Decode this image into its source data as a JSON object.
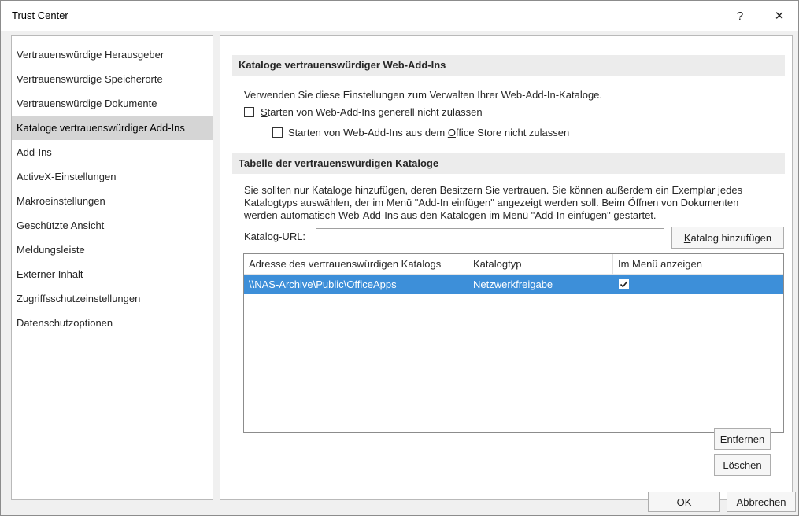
{
  "window": {
    "title": "Trust Center",
    "help_glyph": "?",
    "close_glyph": "✕"
  },
  "sidebar": {
    "items": [
      {
        "label": "Vertrauenswürdige Herausgeber",
        "selected": false
      },
      {
        "label": "Vertrauenswürdige Speicherorte",
        "selected": false
      },
      {
        "label": "Vertrauenswürdige Dokumente",
        "selected": false
      },
      {
        "label": "Kataloge vertrauenswürdiger Add-Ins",
        "selected": true
      },
      {
        "label": "Add-Ins",
        "selected": false
      },
      {
        "label": "ActiveX-Einstellungen",
        "selected": false
      },
      {
        "label": "Makroeinstellungen",
        "selected": false
      },
      {
        "label": "Geschützte Ansicht",
        "selected": false
      },
      {
        "label": "Meldungsleiste",
        "selected": false
      },
      {
        "label": "Externer Inhalt",
        "selected": false
      },
      {
        "label": "Zugriffsschutzeinstellungen",
        "selected": false
      },
      {
        "label": "Datenschutzoptionen",
        "selected": false
      }
    ]
  },
  "web_addins": {
    "header": "Kataloge vertrauenswürdiger Web-Add-Ins",
    "description": "Verwenden Sie diese Einstellungen zum Verwalten Ihrer Web-Add-In-Kataloge.",
    "checkbox1": {
      "pre": "",
      "u": "S",
      "post": "tarten von Web-Add-Ins generell nicht zulassen",
      "checked": false
    },
    "checkbox2": {
      "pre": "Starten von Web-Add-Ins aus dem ",
      "u": "O",
      "post": "ffice Store nicht zulassen",
      "checked": false
    }
  },
  "catalogs": {
    "header": "Tabelle der vertrauenswürdigen Kataloge",
    "description_lines": [
      "Sie sollten nur Kataloge hinzufügen, deren Besitzern Sie vertrauen. Sie können außerdem ein Exemplar jedes",
      "Katalogtyps auswählen, der im Menü \"Add-In einfügen\" angezeigt werden soll. Beim Öffnen von Dokumenten",
      "werden automatisch Web-Add-Ins aus den Katalogen im Menü \"Add-In einfügen\" gestartet."
    ],
    "url_label": {
      "pre": "Katalog-",
      "u": "U",
      "post": "RL:"
    },
    "url_value": "",
    "add_button": {
      "pre": "",
      "u": "K",
      "post": "atalog hinzufügen"
    },
    "columns": [
      "Adresse des vertrauenswürdigen Katalogs",
      "Katalogtyp",
      "Im Menü anzeigen"
    ],
    "rows": [
      {
        "address": "\\\\NAS-Archive\\Public\\OfficeApps",
        "type": "Netzwerkfreigabe",
        "show_in_menu": true
      }
    ],
    "remove_button": {
      "pre": "Ent",
      "u": "f",
      "post": "ernen"
    },
    "clear_button": {
      "pre": "",
      "u": "L",
      "post": "öschen"
    }
  },
  "footer": {
    "ok_label": "OK",
    "cancel_label": "Abbrechen"
  },
  "colors": {
    "selection": "#3d8fd9",
    "sidebar_selected": "#d5d5d5",
    "section_header": "#ececec"
  }
}
